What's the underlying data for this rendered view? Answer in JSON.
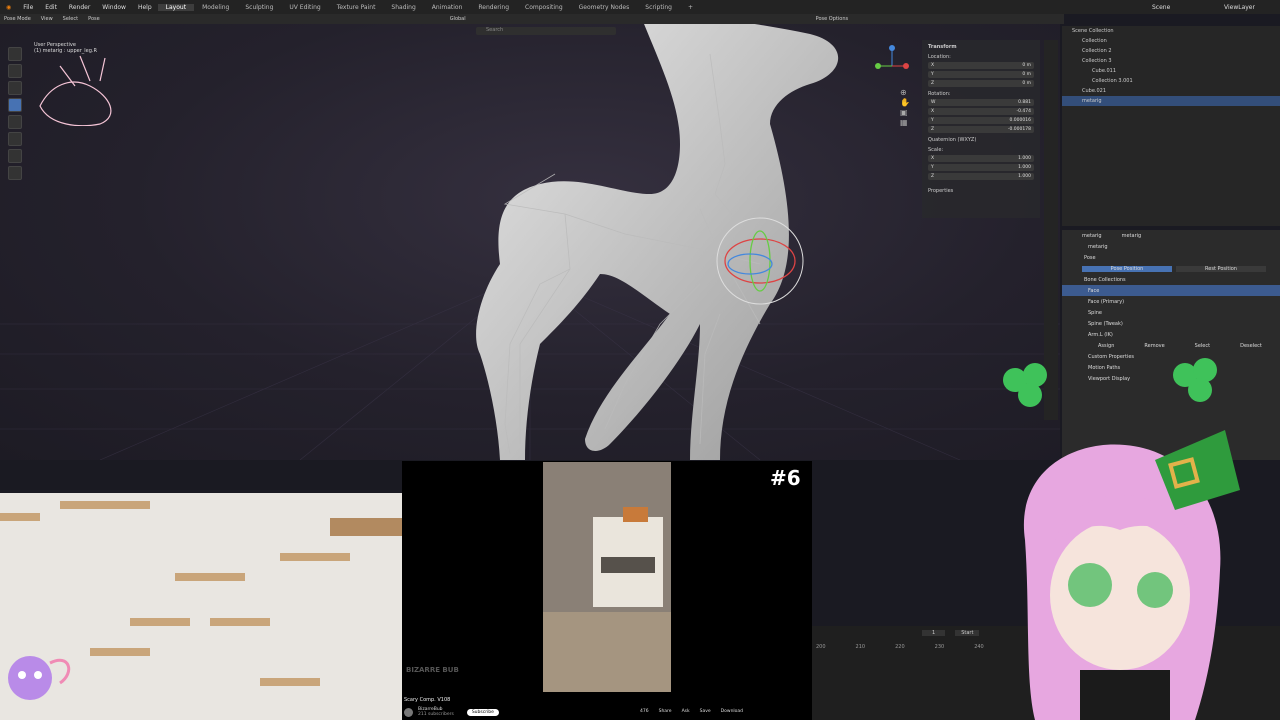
{
  "topbar": {
    "menus": [
      "File",
      "Edit",
      "Render",
      "Window",
      "Help"
    ],
    "workspaces": [
      "Layout",
      "Modeling",
      "Sculpting",
      "UV Editing",
      "Texture Paint",
      "Shading",
      "Animation",
      "Rendering",
      "Compositing",
      "Geometry Nodes",
      "Scripting"
    ],
    "active_workspace": "Layout",
    "scene": "Scene",
    "view_layer": "ViewLayer"
  },
  "header": {
    "mode": "Pose Mode",
    "menus": [
      "View",
      "Select",
      "Pose"
    ],
    "transform": "Global",
    "search_placeholder": "Search",
    "pose_options": "Pose Options"
  },
  "viewport": {
    "info": "User Perspective",
    "info2": "(1) metarig : upper_leg.R"
  },
  "npanel": {
    "title": "Transform",
    "location_label": "Location:",
    "location": [
      {
        "axis": "X",
        "value": "0 m"
      },
      {
        "axis": "Y",
        "value": "0 m"
      },
      {
        "axis": "Z",
        "value": "0 m"
      }
    ],
    "rotation_label": "Rotation:",
    "rotation": [
      {
        "axis": "W",
        "value": "0.881"
      },
      {
        "axis": "X",
        "value": "-0.474"
      },
      {
        "axis": "Y",
        "value": "0.000016"
      },
      {
        "axis": "Z",
        "value": "-0.000178"
      }
    ],
    "rotation_mode": "Quaternion (WXYZ)",
    "scale_label": "Scale:",
    "scale": [
      {
        "axis": "X",
        "value": "1.000"
      },
      {
        "axis": "Y",
        "value": "1.000"
      },
      {
        "axis": "Z",
        "value": "1.000"
      }
    ],
    "properties": "Properties"
  },
  "outliner": {
    "title": "Scene Collection",
    "items": [
      "Collection",
      "Collection 2",
      "Collection 3",
      "Cube.011",
      "Collection 3.001",
      "Cube.021",
      "metarig"
    ],
    "selected": "metarig"
  },
  "props": {
    "breadcrumb_a": "metarig",
    "breadcrumb_b": "metarig",
    "object": "metarig",
    "section_pose": "Pose",
    "pose_position": "Pose Position",
    "rest_position": "Rest Position",
    "bone_collections": "Bone Collections",
    "collections": [
      "Face",
      "Face (Primary)",
      "Spine",
      "Spine (Tweak)",
      "Arm.L (IK)"
    ],
    "assign": "Assign",
    "remove": "Remove",
    "select": "Select",
    "deselect": "Deselect",
    "custom_props": "Custom Properties",
    "motion_paths": "Motion Paths",
    "viewport_display": "Viewport Display"
  },
  "timeline": {
    "frame": "1",
    "start": "Start",
    "ticks": [
      "200",
      "210",
      "220",
      "230",
      "240"
    ]
  },
  "video": {
    "badge": "#6",
    "title": "Scary Comp. V108",
    "channel": "BizarreBub",
    "subs": "211 subscribers",
    "subscribe": "Subscribe",
    "watermark": "BIZARRE BUB",
    "actions": [
      "476",
      "Share",
      "Ask",
      "Save",
      "Download"
    ]
  },
  "colors": {
    "accent": "#3c5b90",
    "viewport_bg": "#24212c",
    "clover": "#3fc25a"
  }
}
